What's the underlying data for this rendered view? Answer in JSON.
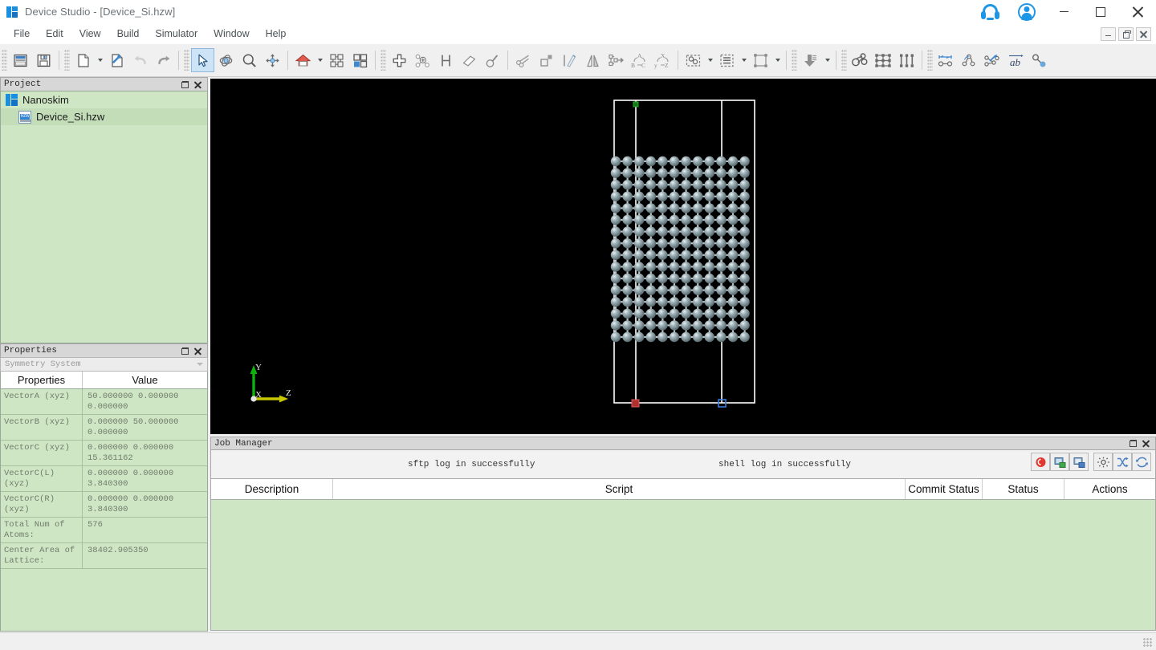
{
  "window": {
    "title": "Device Studio - [Device_Si.hzw]",
    "app_icon": "device-studio-logo",
    "minimize": "minimize-icon",
    "maximize": "maximize-icon",
    "close": "close-icon",
    "support_icon": "headset-icon",
    "account_icon": "user-avatar-icon"
  },
  "menu": {
    "items": [
      {
        "label": "File"
      },
      {
        "label": "Edit"
      },
      {
        "label": "View"
      },
      {
        "label": "Build"
      },
      {
        "label": "Simulator"
      },
      {
        "label": "Window"
      },
      {
        "label": "Help"
      }
    ]
  },
  "toolbar": {
    "groups": [
      {
        "buttons": [
          {
            "name": "print-preview-button",
            "icon": "printer-icon"
          },
          {
            "name": "save-button",
            "icon": "floppy-disk-icon"
          }
        ]
      },
      {
        "buttons": [
          {
            "name": "new-file-button",
            "icon": "new-document-icon",
            "dropdown": true
          },
          {
            "name": "open-file-button",
            "icon": "open-document-icon"
          },
          {
            "name": "undo-button",
            "icon": "undo-arrow-icon",
            "disabled": true
          },
          {
            "name": "redo-button",
            "icon": "redo-arrow-icon"
          }
        ]
      },
      {
        "buttons": [
          {
            "name": "select-tool-button",
            "icon": "cursor-arrow-icon",
            "active": true
          },
          {
            "name": "rotate-tool-button",
            "icon": "rotate-orbit-icon"
          },
          {
            "name": "zoom-tool-button",
            "icon": "magnifier-icon"
          },
          {
            "name": "pan-tool-button",
            "icon": "move-cross-icon"
          }
        ]
      },
      {
        "buttons": [
          {
            "name": "home-view-button",
            "icon": "home-icon",
            "dropdown": true
          },
          {
            "name": "fit-view-button",
            "icon": "fit-to-screen-icon"
          },
          {
            "name": "layout-view-button",
            "icon": "four-panel-icon"
          }
        ]
      },
      {
        "buttons": [
          {
            "name": "add-atom-button",
            "icon": "plus-icon"
          },
          {
            "name": "add-molecule-button",
            "icon": "molecule-plus-icon"
          },
          {
            "name": "add-hydrogen-button",
            "icon": "letter-h-icon"
          },
          {
            "name": "erase-button",
            "icon": "eraser-icon"
          },
          {
            "name": "measure-button",
            "icon": "bond-probe-icon"
          }
        ]
      },
      {
        "buttons": [
          {
            "name": "cut-bond-button",
            "icon": "scissors-icon"
          },
          {
            "name": "supercell-button",
            "icon": "square-corner-icon"
          },
          {
            "name": "slab-button",
            "icon": "slab-slice-icon"
          },
          {
            "name": "mirror-button",
            "icon": "mirror-icon"
          },
          {
            "name": "transform-button",
            "icon": "transform-arrow-icon"
          },
          {
            "name": "reorder-abc-button",
            "icon": "abc-swap-icon"
          },
          {
            "name": "reorder-xyz-button",
            "icon": "xyz-swap-icon"
          }
        ]
      },
      {
        "buttons": [
          {
            "name": "select-atoms-button",
            "icon": "dotted-selection-icon",
            "dropdown": true
          },
          {
            "name": "layer-list-button",
            "icon": "layers-list-icon",
            "dropdown": true
          },
          {
            "name": "bounding-box-button",
            "icon": "bounding-box-icon",
            "dropdown": true
          }
        ]
      },
      {
        "buttons": [
          {
            "name": "import-button",
            "icon": "down-arrow-stack-icon",
            "dropdown": true
          }
        ]
      },
      {
        "buttons": [
          {
            "name": "ball-stick-button",
            "icon": "ball-and-stick-icon"
          },
          {
            "name": "lattice-view-button",
            "icon": "lattice-box-icon"
          },
          {
            "name": "device-view-button",
            "icon": "device-electrode-icon"
          }
        ]
      },
      {
        "buttons": [
          {
            "name": "measure-distance-button",
            "icon": "distance-arrow-icon"
          },
          {
            "name": "measure-angle-button",
            "icon": "angle-icon"
          },
          {
            "name": "measure-dihedral-button",
            "icon": "dihedral-icon"
          },
          {
            "name": "label-button",
            "icon": "ab-label-icon"
          },
          {
            "name": "bond-tool-button",
            "icon": "bond-link-icon"
          }
        ]
      }
    ]
  },
  "project_panel": {
    "title": "Project",
    "float_icon": "restore-icon",
    "close_icon": "close-icon",
    "tree": [
      {
        "label": "Nanoskim",
        "icon": "project-icon",
        "level": 0,
        "selected": true
      },
      {
        "label": "Device_Si.hzw",
        "icon": "hzw-file-icon",
        "level": 1,
        "selected": true
      }
    ]
  },
  "properties_panel": {
    "title": "Properties",
    "float_icon": "restore-icon",
    "close_icon": "close-icon",
    "selector_value": "Symmetry System",
    "columns": [
      "Properties",
      "Value"
    ],
    "rows": [
      {
        "key": "VectorA (xyz)",
        "value": "50.000000 0.000000\n0.000000"
      },
      {
        "key": "VectorB (xyz)",
        "value": "0.000000 50.000000\n0.000000"
      },
      {
        "key": "VectorC (xyz)",
        "value": "0.000000 0.000000\n15.361162"
      },
      {
        "key": "VectorC(L)(xyz)",
        "value": "0.000000 0.000000\n3.840300"
      },
      {
        "key": "VectorC(R)(xyz)",
        "value": "0.000000 0.000000\n3.840300"
      },
      {
        "key": "Total Num of\nAtoms:",
        "value": "576"
      },
      {
        "key": "Center Area of\nLattice:",
        "value": "38402.905350"
      }
    ]
  },
  "viewport": {
    "background": "#000000",
    "axes": [
      {
        "label": "Y",
        "color": "#10b010"
      },
      {
        "label": "Z",
        "color": "#c8c800"
      },
      {
        "label": "X",
        "color": "#dcdcdc"
      }
    ],
    "structure": {
      "atom_color": "#8da2a8",
      "bond_color": "#b9c4c8",
      "cell_color": "#ffffff",
      "columns": 12,
      "rows": 16,
      "left_electrode_marker_color": "#c03030",
      "right_electrode_marker_color": "#3060d0"
    }
  },
  "job_manager": {
    "title": "Job Manager",
    "float_icon": "restore-icon",
    "close_icon": "close-icon",
    "log_messages": [
      "sftp log in successfully",
      "shell log in successfully"
    ],
    "tools": [
      {
        "name": "stop-job-button",
        "icon": "red-stop-icon"
      },
      {
        "name": "upload-job-button",
        "icon": "upload-server-icon"
      },
      {
        "name": "download-job-button",
        "icon": "download-server-icon"
      },
      {
        "name": "job-settings-button",
        "icon": "gear-icon"
      },
      {
        "name": "job-shuffle-button",
        "icon": "shuffle-icon"
      },
      {
        "name": "job-refresh-button",
        "icon": "refresh-icon"
      }
    ],
    "columns": [
      "Description",
      "Script",
      "Commit Status",
      "Status",
      "Actions"
    ],
    "rows": []
  },
  "status_bar": {
    "resize_grip": "resize-grip-icon"
  }
}
